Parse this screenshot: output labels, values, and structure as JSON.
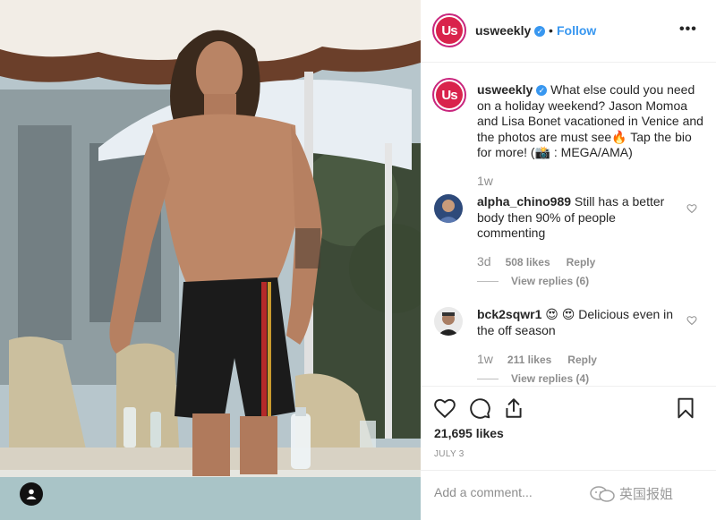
{
  "post": {
    "account": "usweekly",
    "avatar_text": "Us",
    "follow_label": "Follow",
    "separator": "•",
    "more_label": "•••",
    "verified_mark": "✓"
  },
  "caption": {
    "username": "usweekly",
    "text": " What else could you need on a holiday weekend? Jason Momoa and Lisa Bonet vacationed in Venice and the photos are must see🔥  Tap the bio for more! (📸 : MEGA/AMA)",
    "time": "1w"
  },
  "comments": [
    {
      "username": "alpha_chino989",
      "text": " Still has a better body then 90% of people commenting",
      "time": "3d",
      "likes": "508 likes",
      "reply_label": "Reply",
      "view_replies": "View replies (6)"
    },
    {
      "username": "bck2sqwr1",
      "text": " 😍 😍  Delicious even in the off season",
      "time": "1w",
      "likes": "211 likes",
      "reply_label": "Reply",
      "view_replies": "View replies (4)"
    }
  ],
  "actions": {
    "likes": "21,695 likes",
    "date": "JULY 3",
    "comment_placeholder": "Add a comment..."
  },
  "watermark": {
    "text": "英国报姐"
  },
  "icons": {
    "like": "heart-icon",
    "comment": "comment-bubble-icon",
    "share": "share-icon",
    "save": "bookmark-icon",
    "tag": "user-tag-icon"
  },
  "colors": {
    "link_blue": "#3897f0",
    "brand_red": "#d9234c",
    "muted": "#8e8e8e",
    "text": "#262626"
  }
}
